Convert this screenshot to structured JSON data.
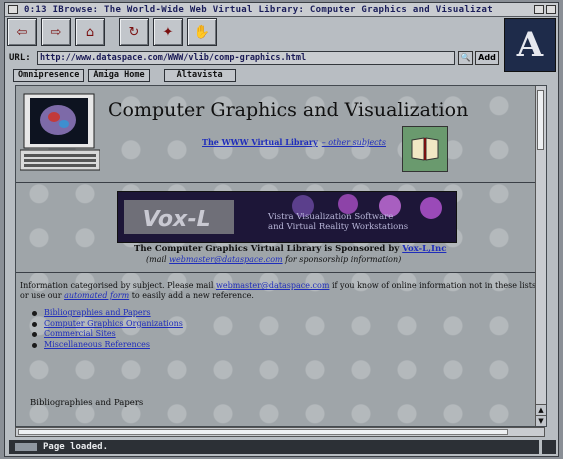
{
  "window": {
    "title": "0:13 IBrowse: The World-Wide Web Virtual Library: Computer Graphics and Visualizat"
  },
  "toolbar": {
    "buttons": [
      {
        "name": "back-button",
        "icon": "back-arrow-icon",
        "glyph": "⇦"
      },
      {
        "name": "forward-button",
        "icon": "forward-arrow-icon",
        "glyph": "⇨"
      },
      {
        "name": "home-button",
        "icon": "home-icon",
        "glyph": "⌂"
      },
      {
        "name": "reload-button",
        "icon": "reload-icon",
        "glyph": "↻"
      },
      {
        "name": "images-button",
        "icon": "images-icon",
        "glyph": "✦"
      },
      {
        "name": "stop-button",
        "icon": "stop-icon",
        "glyph": "✋"
      }
    ]
  },
  "logo": {
    "letter": "A"
  },
  "url": {
    "label": "URL:",
    "value": "http://www.dataspace.com/WWW/vlib/comp-graphics.html",
    "add_label": "Add"
  },
  "hotlist": [
    "Omnipresence",
    "Amiga Home",
    "Altavista"
  ],
  "page": {
    "heading": "Computer Graphics and Visualization",
    "vlib_link": "The WWW Virtual Library",
    "vlib_sub": "– other subjects",
    "banner_text_1": "Vistra Visualization Software",
    "banner_text_2": "and Virtual Reality Workstations",
    "sponsor_prefix": "The Computer Graphics Virtual Library is Sponsored by",
    "sponsor_link": "Vox-L,Inc",
    "mail_prefix": "(mail",
    "mail_link": "webmaster@dataspace.com",
    "mail_suffix": "for sponsorship information)",
    "info_1": "Information categorised by subject. Please mail",
    "info_mail": "webmaster@dataspace.com",
    "info_2": "if you know of online information not in these lists; or use our",
    "info_form": "automated form",
    "info_3": "to easily add a new reference.",
    "list": [
      "Bibliographies and Papers",
      "Computer Graphics Organizations",
      "Commercial Sites",
      "Miscellaneous References"
    ],
    "section_heading": "Bibliographies and Papers"
  },
  "status": {
    "text": "Page loaded."
  }
}
